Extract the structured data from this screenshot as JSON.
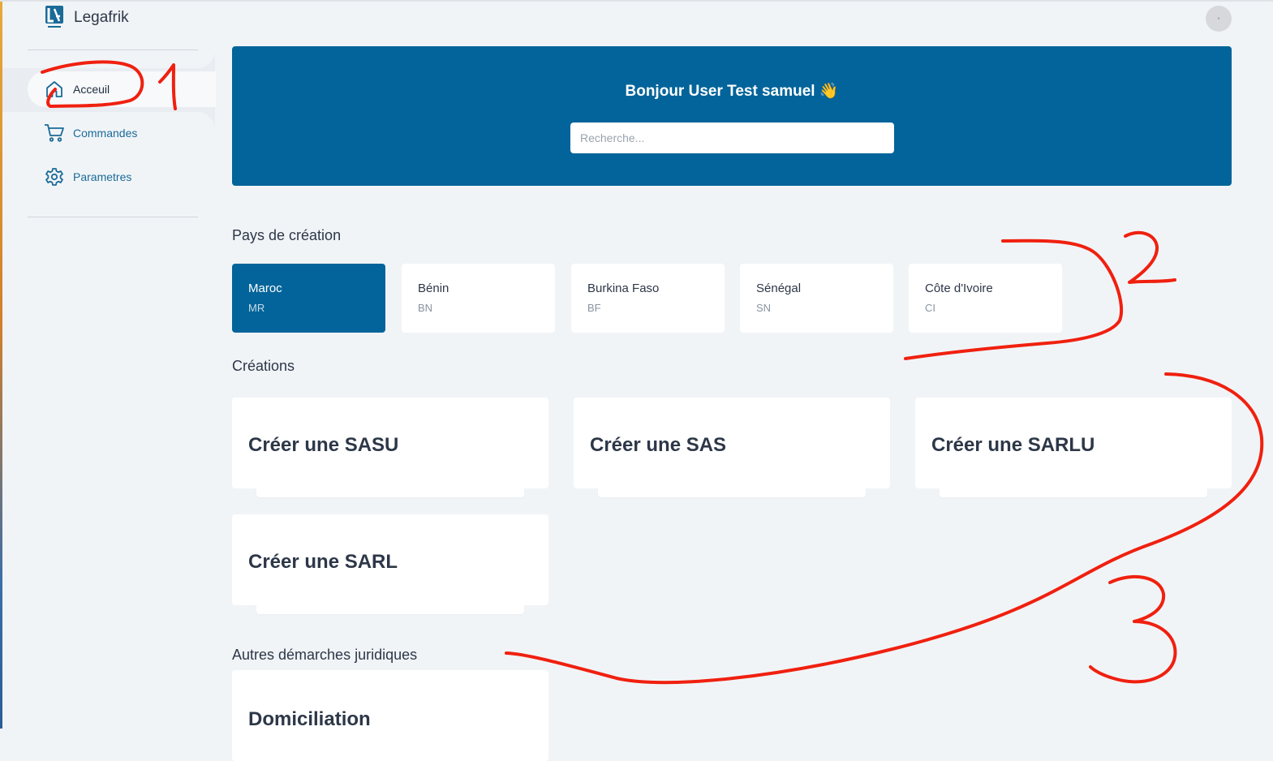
{
  "app": {
    "name": "Legafrik",
    "logo_icon": "legafrik-logo-icon"
  },
  "sidebar": {
    "items": [
      {
        "label": "Acceuil",
        "icon": "home-icon",
        "active": true
      },
      {
        "label": "Commandes",
        "icon": "cart-icon",
        "active": false
      },
      {
        "label": "Parametres",
        "icon": "gear-icon",
        "active": false
      }
    ]
  },
  "header": {
    "avatar_icon": "user-avatar"
  },
  "hero": {
    "greeting": "Bonjour User Test samuel 👋",
    "search_placeholder": "Recherche..."
  },
  "countries": {
    "title": "Pays de création",
    "items": [
      {
        "name": "Maroc",
        "code": "MR",
        "selected": true
      },
      {
        "name": "Bénin",
        "code": "BN",
        "selected": false
      },
      {
        "name": "Burkina Faso",
        "code": "BF",
        "selected": false
      },
      {
        "name": "Sénégal",
        "code": "SN",
        "selected": false
      },
      {
        "name": "Côte d'Ivoire",
        "code": "CI",
        "selected": false
      }
    ]
  },
  "creations": {
    "title": "Créations",
    "items": [
      {
        "label": "Créer une SASU"
      },
      {
        "label": "Créer une SAS"
      },
      {
        "label": "Créer une SARLU"
      },
      {
        "label": "Créer une SARL"
      }
    ]
  },
  "autres": {
    "title": "Autres démarches juridiques",
    "items": [
      {
        "label": "Domiciliation"
      }
    ]
  },
  "annotations": {
    "color": "#f0200f",
    "labels": [
      "1",
      "2",
      "3"
    ]
  },
  "colors": {
    "primary": "#02649a",
    "page_bg": "#f1f4f7",
    "sidebar_link": "#1a6b97"
  }
}
